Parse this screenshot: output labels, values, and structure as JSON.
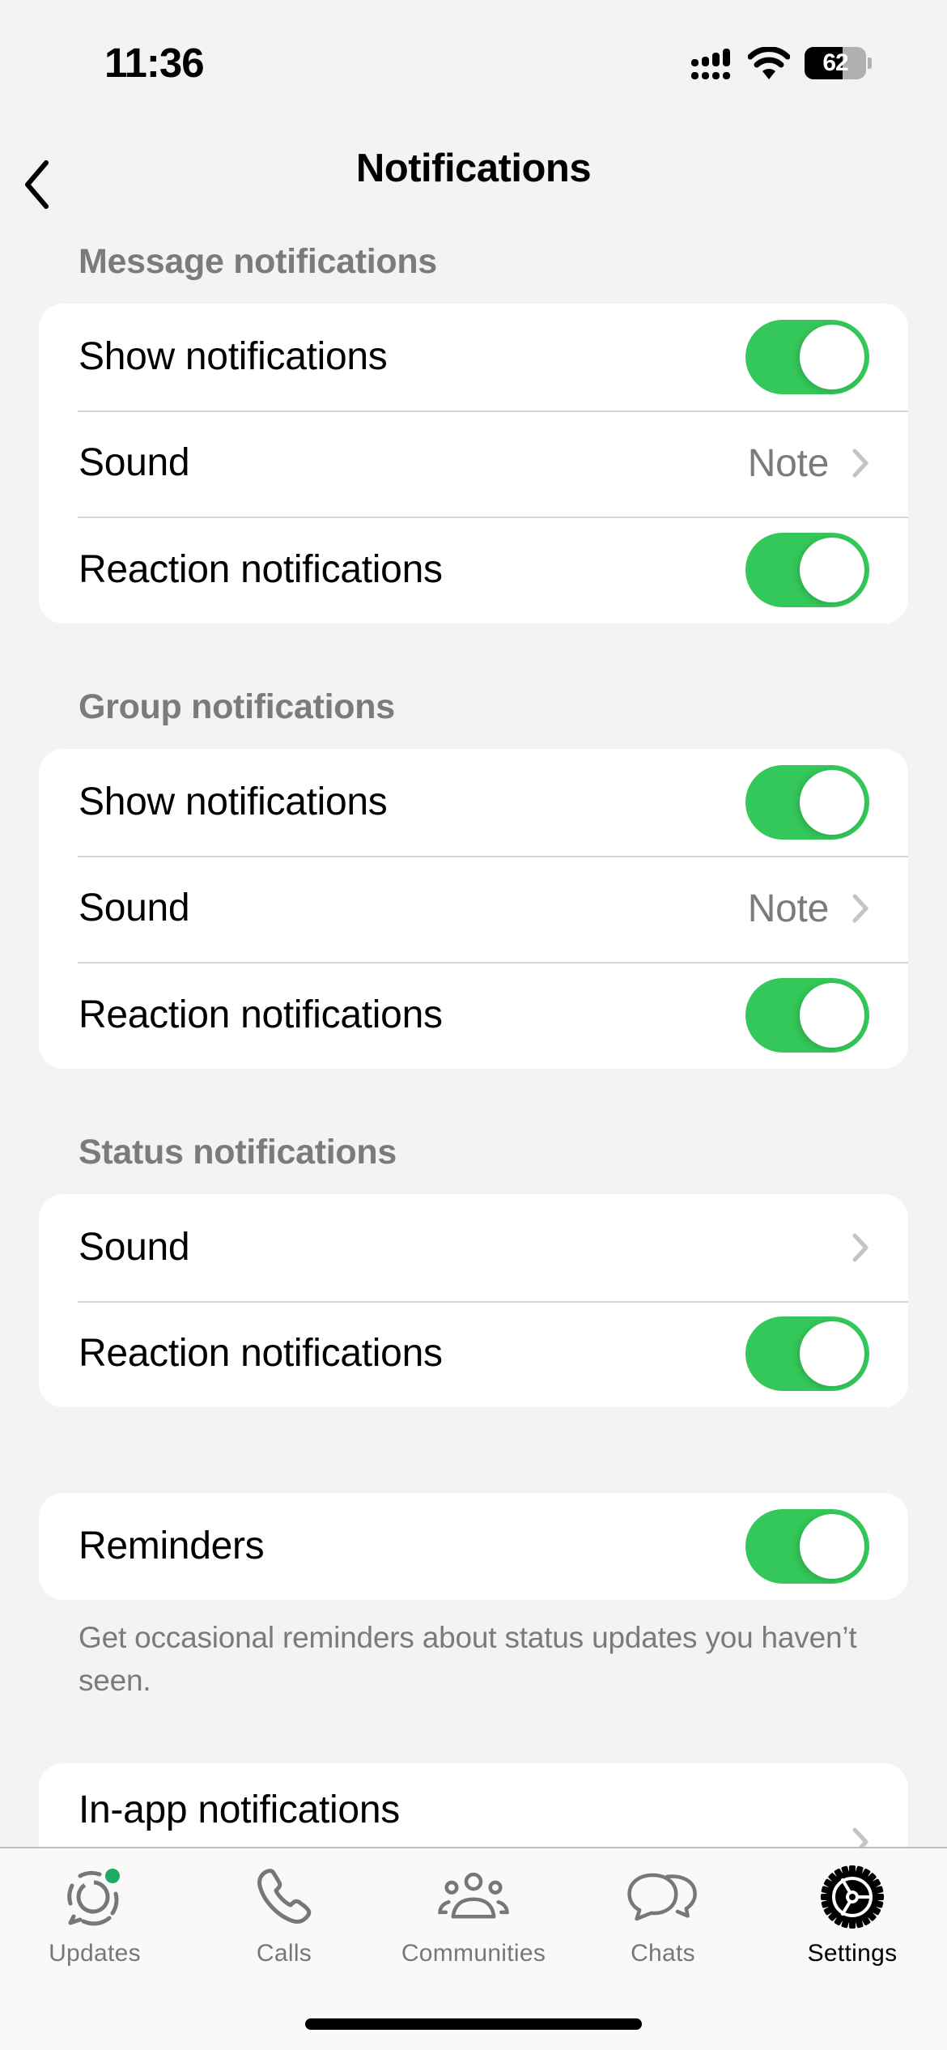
{
  "status_bar": {
    "time": "11:36",
    "battery_level": "62",
    "battery_fraction": 0.62,
    "signal_icon": "cellular-signal-icon",
    "wifi_icon": "wifi-icon"
  },
  "nav": {
    "title": "Notifications",
    "back_icon": "chevron-left-icon"
  },
  "colors": {
    "toggle_on": "#34c759",
    "badge_dot": "#1daa61",
    "secondary_text": "#7b7b7b",
    "background": "#f3f3f3"
  },
  "sections": {
    "message": {
      "header": "Message notifications",
      "rows": [
        {
          "label": "Show notifications",
          "type": "toggle",
          "on": true
        },
        {
          "label": "Sound",
          "type": "link",
          "value": "Note"
        },
        {
          "label": "Reaction notifications",
          "type": "toggle",
          "on": true
        }
      ]
    },
    "group": {
      "header": "Group notifications",
      "rows": [
        {
          "label": "Show notifications",
          "type": "toggle",
          "on": true
        },
        {
          "label": "Sound",
          "type": "link",
          "value": "Note"
        },
        {
          "label": "Reaction notifications",
          "type": "toggle",
          "on": true
        }
      ]
    },
    "status": {
      "header": "Status notifications",
      "rows": [
        {
          "label": "Sound",
          "type": "link",
          "value": ""
        },
        {
          "label": "Reaction notifications",
          "type": "toggle",
          "on": true
        }
      ]
    },
    "reminders": {
      "rows": [
        {
          "label": "Reminders",
          "type": "toggle",
          "on": true
        }
      ],
      "footer": "Get occasional reminders about status updates you haven’t seen."
    },
    "inapp": {
      "rows": [
        {
          "label": "In-app notifications",
          "type": "link"
        }
      ]
    }
  },
  "tabbar": {
    "tabs": [
      {
        "label": "Updates",
        "icon": "updates-icon",
        "active": false,
        "badge": true
      },
      {
        "label": "Calls",
        "icon": "phone-icon",
        "active": false
      },
      {
        "label": "Communities",
        "icon": "communities-icon",
        "active": false
      },
      {
        "label": "Chats",
        "icon": "chats-icon",
        "active": false
      },
      {
        "label": "Settings",
        "icon": "settings-gear-icon",
        "active": true
      }
    ]
  }
}
